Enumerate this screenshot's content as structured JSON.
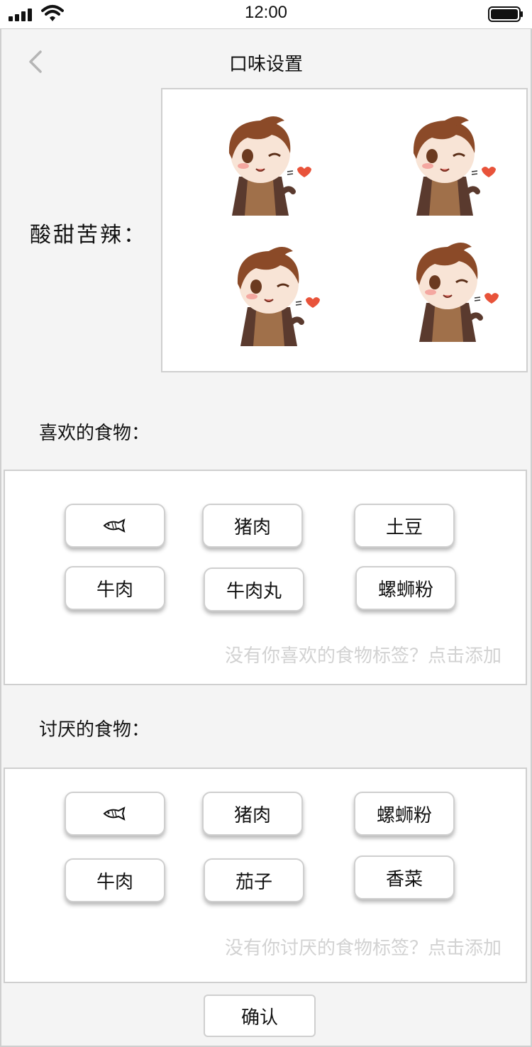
{
  "status_bar": {
    "time": "12:00"
  },
  "header": {
    "title": "口味设置",
    "back_icon": "chevron-left-icon"
  },
  "taste": {
    "label": "酸甜苦辣：",
    "stickers": [
      "chibi-chef-sticker",
      "chibi-chef-sticker",
      "chibi-chef-sticker",
      "chibi-chef-sticker"
    ]
  },
  "liked": {
    "label": "喜欢的食物：",
    "tags": [
      "fish-icon",
      "猪肉",
      "土豆",
      "牛肉",
      "牛肉丸",
      "螺蛳粉"
    ],
    "hint": "没有你喜欢的食物标签？点击添加"
  },
  "disliked": {
    "label": "讨厌的食物：",
    "tags": [
      "fish-icon",
      "猪肉",
      "螺蛳粉",
      "牛肉",
      "茄子",
      "香菜"
    ],
    "hint": "没有你讨厌的食物标签？点击添加"
  },
  "confirm_label": "确认",
  "colors": {
    "background": "#f4f4f4",
    "border": "#cfcfcf",
    "hint": "#d2d2d2",
    "heart": "#e8533a",
    "hair": "#8b4a28"
  }
}
